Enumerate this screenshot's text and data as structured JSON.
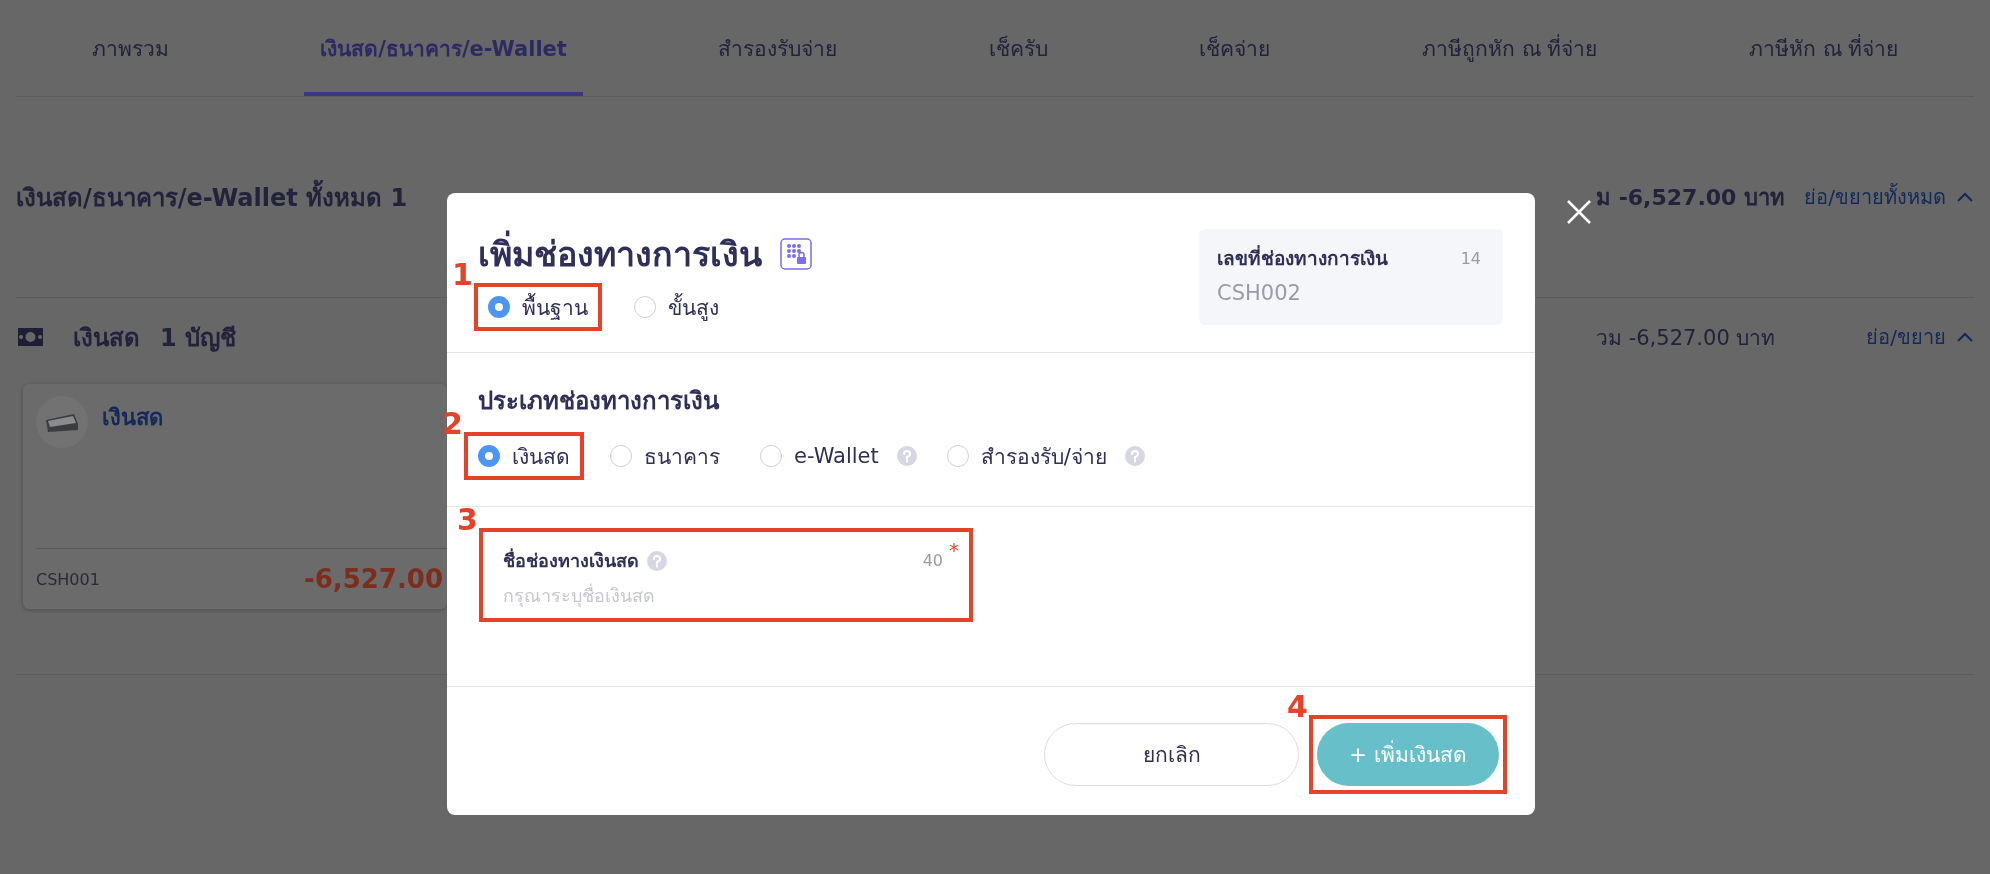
{
  "tabs": [
    {
      "label": "ภาพรวม",
      "selected": false
    },
    {
      "label": "เงินสด/ธนาคาร/e-Wallet",
      "selected": true
    },
    {
      "label": "สำรองรับจ่าย",
      "selected": false
    },
    {
      "label": "เช็ครับ",
      "selected": false
    },
    {
      "label": "เช็คจ่าย",
      "selected": false
    },
    {
      "label": "ภาษีถูกหัก ณ ที่จ่าย",
      "selected": false
    },
    {
      "label": "ภาษีหัก ณ ที่จ่าย",
      "selected": false
    }
  ],
  "summary": {
    "title": "เงินสด/ธนาคาร/e-Wallet ทั้งหมด 1",
    "total": "ม -6,527.00 บาท",
    "toggle": "ย่อ/ขยายทั้งหมด"
  },
  "group": {
    "name": "เงินสด",
    "count": "1 บัญชี",
    "total": "วม -6,527.00 บาท",
    "toggle": "ย่อ/ขยาย"
  },
  "accounts": [
    {
      "name": "เงินสด",
      "code": "CSH001",
      "balance": "-6,527.00"
    }
  ],
  "dialog": {
    "title": "เพิ่มช่องทางการเงิน",
    "modes": [
      {
        "label": "พื้นฐาน",
        "selected": true,
        "step": "1"
      },
      {
        "label": "ขั้นสูง",
        "selected": false
      }
    ],
    "number_box": {
      "label": "เลขที่ช่องทางการเงิน",
      "count": "14",
      "value": "CSH002"
    },
    "type_heading": "ประเภทช่องทางการเงิน",
    "types": [
      {
        "label": "เงินสด",
        "selected": true,
        "help": false,
        "step": "2"
      },
      {
        "label": "ธนาคาร",
        "selected": false,
        "help": false
      },
      {
        "label": "e-Wallet",
        "selected": false,
        "help": true
      },
      {
        "label": "สำรองรับ/จ่าย",
        "selected": false,
        "help": true
      }
    ],
    "name_field": {
      "label": "ชื่อช่องทางเงินสด",
      "help": true,
      "counter": "40",
      "required_mark": "*",
      "placeholder": "กรุณาระบุชื่อเงินสด",
      "step": "3"
    },
    "buttons": [
      {
        "kind": "secondary",
        "label": "ยกเลิก"
      },
      {
        "kind": "primary",
        "label": "+ เพิ่มเงินสด",
        "step": "4"
      }
    ]
  }
}
